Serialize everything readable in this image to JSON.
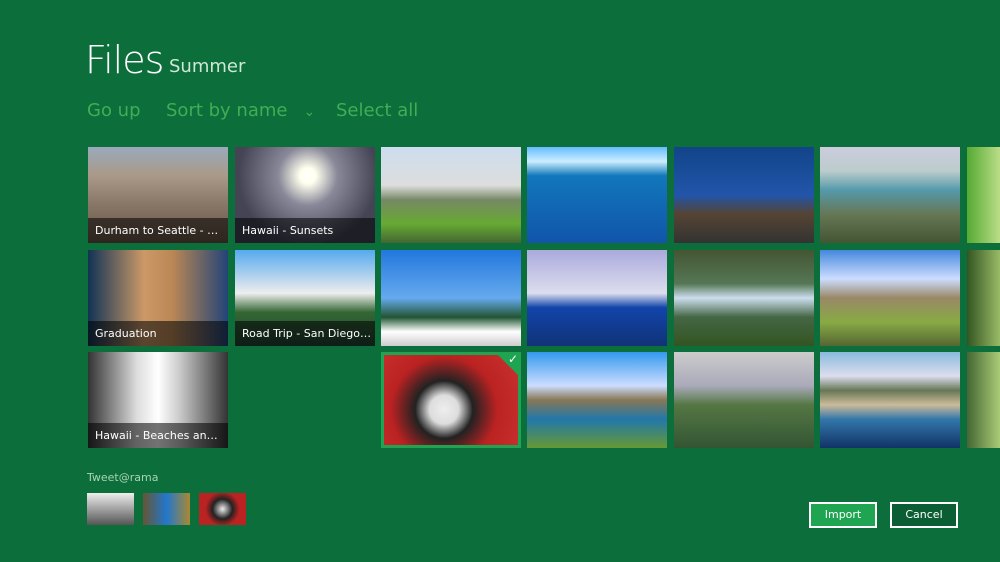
{
  "header": {
    "title": "Files",
    "location": "Summer"
  },
  "commands": {
    "go_up": "Go up",
    "sort": "Sort by name",
    "sort_icon": "chevron-down-icon",
    "select_all": "Select all"
  },
  "folders": [
    {
      "label": "Durham to Seattle - Road..."
    },
    {
      "label": "Hawaii - Sunsets"
    },
    {
      "label": "Graduation"
    },
    {
      "label": "Road Trip - San Diego to ..."
    },
    {
      "label": "Hawaii - Beaches and Wa..."
    }
  ],
  "selection_basket": {
    "label": "Tweet@rama"
  },
  "buttons": {
    "import": "Import",
    "cancel": "Cancel"
  },
  "colors": {
    "background": "#0b6e3b",
    "accent": "#1fa552",
    "command_text": "#3fae55"
  }
}
